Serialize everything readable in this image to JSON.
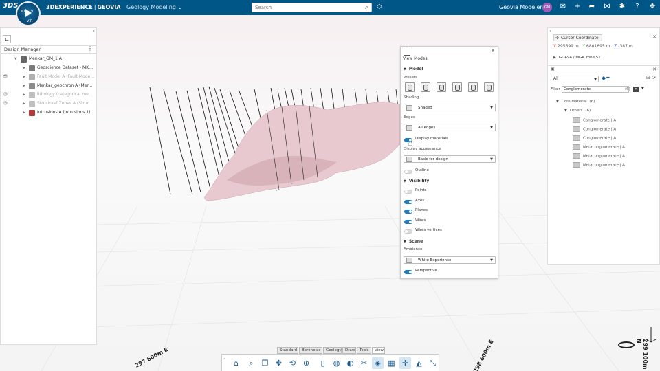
{
  "topbar": {
    "brand_logo": "3DS",
    "brand": "3DEXPERIENCE",
    "separator": "|",
    "product": "GEOVIA",
    "app_name": "Geology Modeling",
    "compass": {
      "label_3d": "3D",
      "label_v": "V",
      "label_vr": "V,R"
    },
    "search_placeholder": "Search",
    "user_name": "Geovia Modeler",
    "avatar_initials": "GM",
    "accent": "#005686"
  },
  "left_panel": {
    "title": "Design Manager",
    "items": [
      {
        "label": "Menkar_GM_1 A",
        "level": 0,
        "dim": false,
        "color": "#666666",
        "eye": ""
      },
      {
        "label": "Geoscience Dataset - MKRB...",
        "level": 1,
        "dim": false,
        "color": "#7a7a7a",
        "eye": ""
      },
      {
        "label": "Fault Model A (Fault Model 1)",
        "level": 1,
        "dim": true,
        "color": "#b0b0b0",
        "eye": "👁"
      },
      {
        "label": "Menkar_geochron A (Menkar_...",
        "level": 1,
        "dim": false,
        "color": "#8a8a8a",
        "eye": ""
      },
      {
        "label": "lithology (categorical measure...",
        "level": 1,
        "dim": true,
        "color": "#c0c0c0",
        "eye": "👁"
      },
      {
        "label": "Structural Zones A (Structural...",
        "level": 1,
        "dim": true,
        "color": "#c0c0c0",
        "eye": "👁"
      },
      {
        "label": "Intrusions A (Intrusions 1)",
        "level": 1,
        "dim": false,
        "color": "#b23a3a",
        "eye": ""
      }
    ]
  },
  "viewport": {
    "axis_labels": [
      "297 600m E",
      "298 600m E",
      "299 100m N"
    ]
  },
  "view_modes": {
    "title": "View Modes",
    "sections": {
      "model": "Model",
      "visibility": "Visibility",
      "scene": "Scene"
    },
    "labels": {
      "presets": "Presets",
      "shading": "Shading",
      "edges": "Edges",
      "appearance": "Display appearance",
      "ambience": "Ambience"
    },
    "shading_value": "Shaded",
    "edges_value": "All edges",
    "appearance_value": "Basic for design",
    "ambience_value": "White Experience",
    "toggles": {
      "display_materials": {
        "label": "Display materials",
        "on": true
      },
      "outline": {
        "label": "Outline",
        "on": false
      },
      "points": {
        "label": "Points",
        "on": false
      },
      "axes": {
        "label": "Axes",
        "on": true
      },
      "planes": {
        "label": "Planes",
        "on": true
      },
      "wires": {
        "label": "Wires",
        "on": true
      },
      "wires_vertices": {
        "label": "Wires vertices",
        "on": false
      },
      "perspective": {
        "label": "Perspective",
        "on": true
      }
    }
  },
  "right_panel": {
    "tab_title": "Cursor Coordinate",
    "x_label": "X",
    "x_value": "295699 m",
    "y_label": "Y",
    "y_value": "6801695 m",
    "z_label": "Z",
    "z_value": "-387 m",
    "crs": "GDA94 / MGA zone 51",
    "filter_scope": "All",
    "filter_label": "Filter",
    "filter_value": "Conglomerate",
    "filter_count": "(6)",
    "tree": [
      {
        "label": "Core Material",
        "count": "(6)",
        "level": 0,
        "kind": "group"
      },
      {
        "label": "Others",
        "count": "(6)",
        "level": 1,
        "kind": "group"
      },
      {
        "label": "Conglomerate | A",
        "level": 2,
        "kind": "item"
      },
      {
        "label": "Conglomerate | A",
        "level": 2,
        "kind": "item"
      },
      {
        "label": "Conglomerate | A",
        "level": 2,
        "kind": "item"
      },
      {
        "label": "Metaconglomerate | A",
        "level": 2,
        "kind": "item"
      },
      {
        "label": "Metaconglomerate | A",
        "level": 2,
        "kind": "item"
      },
      {
        "label": "Metaconglomerate | A",
        "level": 2,
        "kind": "item"
      }
    ]
  },
  "bottom_tabs": [
    "Standard",
    "Boreholes",
    "Geology",
    "Draw",
    "Tools",
    "View"
  ],
  "active_bottom_tab": "View",
  "toolbar_icons": [
    "home-icon",
    "zoom-icon",
    "layers-icon",
    "pan-icon",
    "rotate-icon",
    "zoom-area-icon",
    "cylinder-icon",
    "globe-icon",
    "shading-icon",
    "section-icon",
    "view-modes-icon",
    "grid-icon",
    "axes-icon",
    "compass-icon",
    "measure-icon"
  ]
}
